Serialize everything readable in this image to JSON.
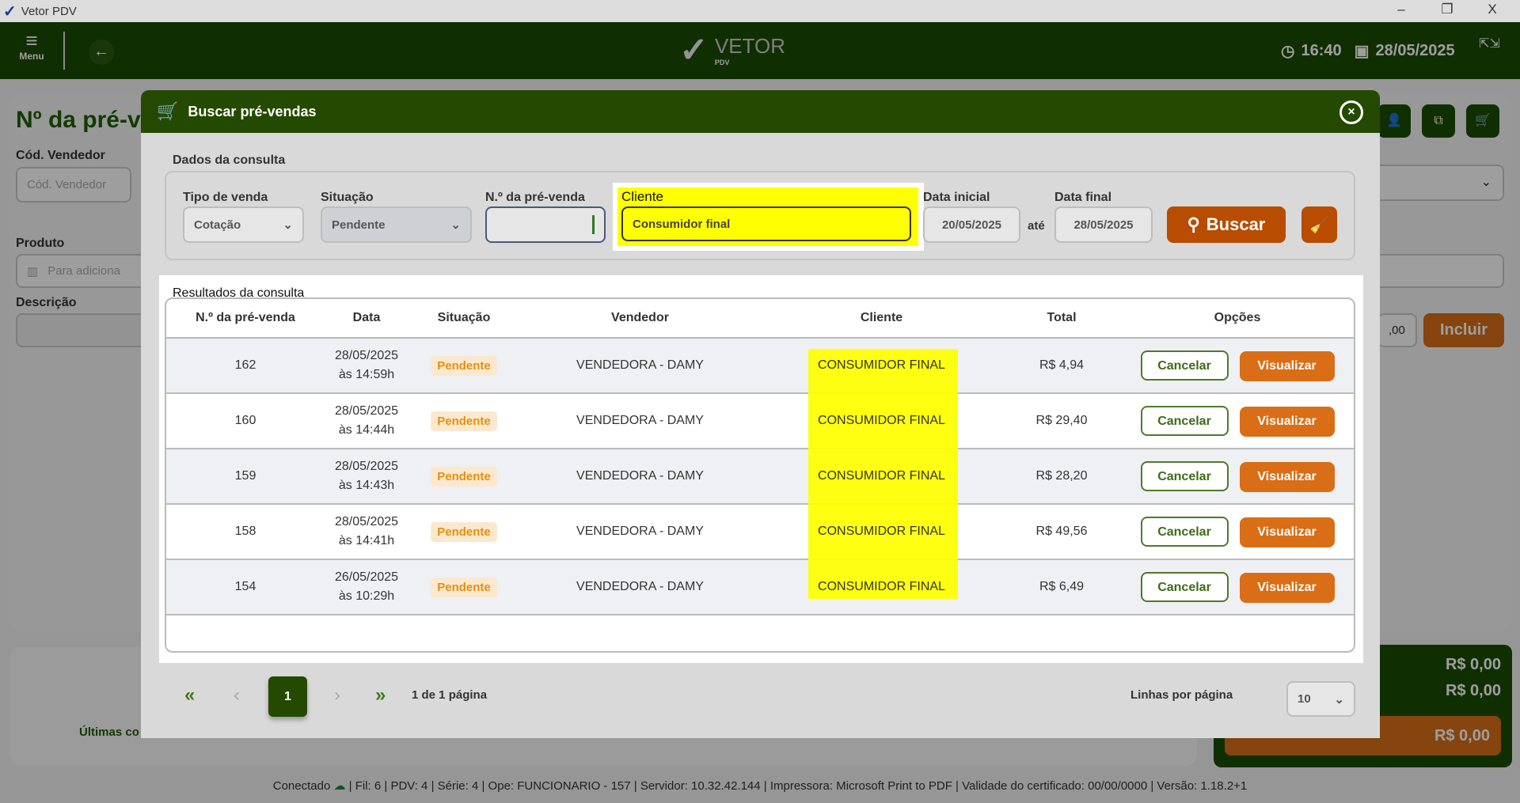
{
  "window": {
    "title": "Vetor PDV",
    "minimize": "–",
    "restore": "❐",
    "close": "X"
  },
  "header": {
    "menu_label": "Menu",
    "logo_text": "VETOR",
    "logo_sub": "PDV",
    "time": "16:40",
    "date": "28/05/2025"
  },
  "background": {
    "title": "Nº da pré-v",
    "cod_vendedor_label": "Cód. Vendedor",
    "cod_vendedor_placeholder": "Cód. Vendedor",
    "produto_label": "Produto",
    "produto_placeholder": "Para adiciona",
    "descricao_label": "Descrição",
    "qty_value": ",00",
    "incluir": "Incluir",
    "ultimas": "Últimas co",
    "totals": [
      "R$ 0,00",
      "R$ 0,00",
      "R$ 0,00"
    ]
  },
  "modal": {
    "title": "Buscar pré-vendas",
    "query_section": "Dados da consulta",
    "tipo_label": "Tipo de venda",
    "tipo_value": "Cotação",
    "situacao_label": "Situação",
    "situacao_value": "Pendente",
    "numero_label": "N.º da pré-venda",
    "numero_value": "",
    "cliente_label": "Cliente",
    "cliente_value": "Consumidor final",
    "data_inicial_label": "Data inicial",
    "data_inicial_value": "20/05/2025",
    "ate": "até",
    "data_final_label": "Data final",
    "data_final_value": "28/05/2025",
    "buscar": "Buscar",
    "results_section": "Resultados da consulta",
    "columns": [
      "N.º da pré-venda",
      "Data",
      "Situação",
      "Vendedor",
      "Cliente",
      "Total",
      "Opções"
    ],
    "rows": [
      {
        "num": "162",
        "date": "28/05/2025",
        "time": "às 14:59h",
        "status": "Pendente",
        "vendedor": "VENDEDORA - DAMY",
        "cliente": "CONSUMIDOR FINAL",
        "total": "R$ 4,94"
      },
      {
        "num": "160",
        "date": "28/05/2025",
        "time": "às 14:44h",
        "status": "Pendente",
        "vendedor": "VENDEDORA - DAMY",
        "cliente": "CONSUMIDOR FINAL",
        "total": "R$ 29,40"
      },
      {
        "num": "159",
        "date": "28/05/2025",
        "time": "às 14:43h",
        "status": "Pendente",
        "vendedor": "VENDEDORA - DAMY",
        "cliente": "CONSUMIDOR FINAL",
        "total": "R$ 28,20"
      },
      {
        "num": "158",
        "date": "28/05/2025",
        "time": "às 14:41h",
        "status": "Pendente",
        "vendedor": "VENDEDORA - DAMY",
        "cliente": "CONSUMIDOR FINAL",
        "total": "R$ 49,56"
      },
      {
        "num": "154",
        "date": "26/05/2025",
        "time": "às 10:29h",
        "status": "Pendente",
        "vendedor": "VENDEDORA - DAMY",
        "cliente": "CONSUMIDOR FINAL",
        "total": "R$ 6,49"
      }
    ],
    "cancel_label": "Cancelar",
    "view_label": "Visualizar",
    "pagination": {
      "first": "«",
      "prev": "‹",
      "current": "1",
      "next": "›",
      "last": "»",
      "info": "1 de 1 página",
      "rows_label": "Linhas por página",
      "rows_value": "10"
    }
  },
  "statusbar": {
    "conectado": "Conectado",
    "info": "| Fil: 6 | PDV: 4 | Série: 4 | Ope: FUNCIONARIO - 157 | Servidor: 10.32.42.144 | Impressora: Microsoft Print to PDF | Validade do certificado: 00/00/0000 | Versão: 1.18.2+1"
  },
  "colors": {
    "green": "#234a00",
    "orange": "#d96e17",
    "highlight": "#ffff00"
  }
}
